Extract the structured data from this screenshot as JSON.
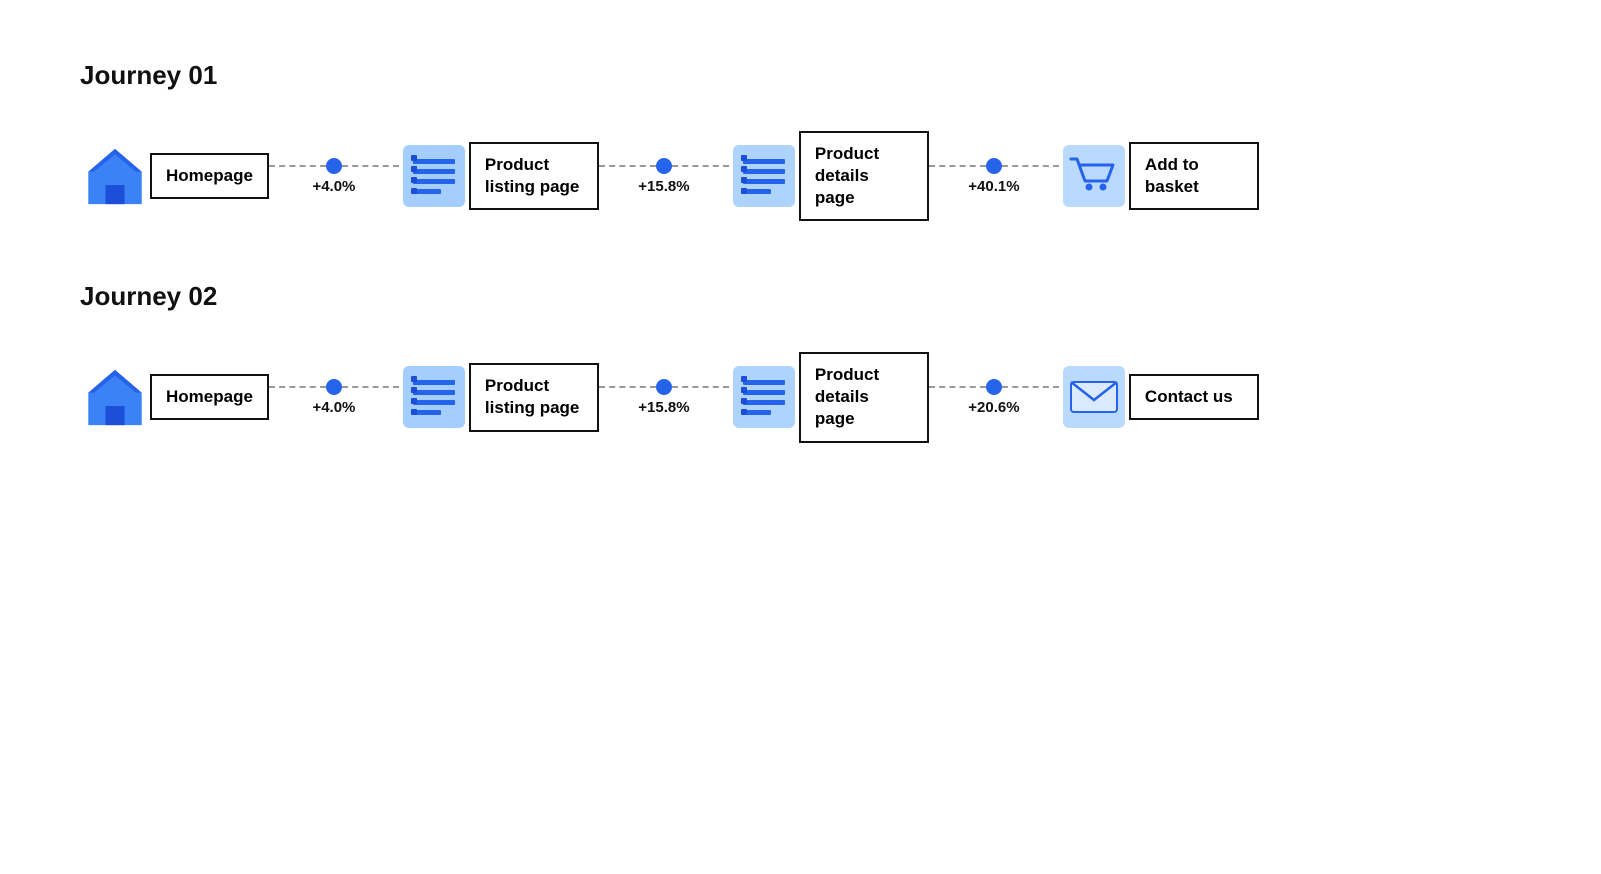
{
  "journey1": {
    "title": "Journey 01",
    "nodes": [
      {
        "id": "homepage1",
        "label": "Homepage",
        "icon": "home",
        "multiline": false
      },
      {
        "id": "plp1",
        "label": "Product listing page",
        "icon": "list",
        "multiline": true
      },
      {
        "id": "pdp1",
        "label": "Product details page",
        "icon": "list",
        "multiline": true
      },
      {
        "id": "basket1",
        "label": "Add to basket",
        "icon": "cart",
        "multiline": true
      }
    ],
    "connectors": [
      {
        "id": "c1_1",
        "pct": "+4.0%"
      },
      {
        "id": "c1_2",
        "pct": "+15.8%"
      },
      {
        "id": "c1_3",
        "pct": "+40.1%"
      }
    ]
  },
  "journey2": {
    "title": "Journey 02",
    "nodes": [
      {
        "id": "homepage2",
        "label": "Homepage",
        "icon": "home",
        "multiline": false
      },
      {
        "id": "plp2",
        "label": "Product listing page",
        "icon": "list",
        "multiline": true
      },
      {
        "id": "pdp2",
        "label": "Product details page",
        "icon": "list",
        "multiline": true
      },
      {
        "id": "contact2",
        "label": "Contact us",
        "icon": "mail",
        "multiline": true
      }
    ],
    "connectors": [
      {
        "id": "c2_1",
        "pct": "+4.0%"
      },
      {
        "id": "c2_2",
        "pct": "+15.8%"
      },
      {
        "id": "c2_3",
        "pct": "+20.6%"
      }
    ]
  }
}
